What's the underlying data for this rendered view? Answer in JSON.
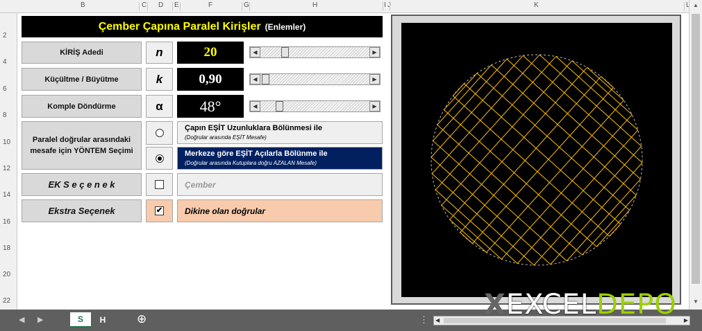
{
  "columns": [
    "B",
    "C",
    "D",
    "E",
    "F",
    "G",
    "H",
    "I",
    "J",
    "K",
    "L"
  ],
  "rows": [
    "2",
    "4",
    "6",
    "8",
    "10",
    "12",
    "14",
    "16",
    "18",
    "20",
    "22"
  ],
  "title": {
    "main": "Çember Çapına Paralel Kirişler",
    "sub": "(Enlemler)"
  },
  "params": [
    {
      "label": "KİRİŞ  Adedi",
      "symbol": "n",
      "value": "20"
    },
    {
      "label": "Küçültme / Büyütme",
      "symbol": "k",
      "value": "0,90"
    },
    {
      "label": "Komple Döndürme",
      "symbol": "α",
      "value": "48°"
    }
  ],
  "method": {
    "label": "Paralel doğrular arasındaki mesafe için YÖNTEM Seçimi",
    "options": [
      {
        "title": "Çapın EŞİT Uzunluklara Bölünmesi ile",
        "note": "(Doğrular arasında EŞİT Mesafe)",
        "selected": false
      },
      {
        "title": "Merkeze göre EŞİT Açılarla Bölünme ile",
        "note": "(Doğrular arasında Kutuplara doğru AZALAN Mesafe)",
        "selected": true
      }
    ]
  },
  "ek": {
    "label": "EK  S e ç e n e k",
    "desc": "Çember",
    "checked": false
  },
  "extra": {
    "label": "Ekstra Seçenek",
    "desc": "Dikine olan doğrular",
    "checked": true,
    "mark": "✔"
  },
  "sheet_tabs": [
    "S",
    "H"
  ],
  "add_sheet": "⊕",
  "logo": {
    "x": "X",
    "excel": "EXCEL",
    "depo": "DEPO"
  },
  "colors": {
    "yellow": "#ffff00",
    "navy": "#002060",
    "peach": "#f8cbad",
    "chord": "#ffc000",
    "excel_green": "#217346"
  },
  "figure": {
    "n": 20,
    "k": 0.9,
    "angle_deg": 48
  }
}
